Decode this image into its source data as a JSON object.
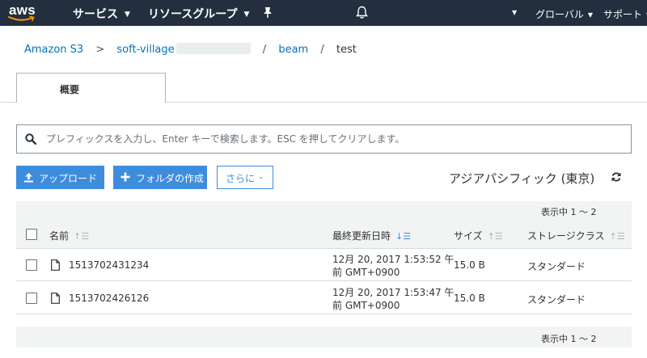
{
  "topnav": {
    "logo_text": "aws",
    "services": "サービス",
    "resource_groups": "リソースグループ",
    "global": "グローバル",
    "support": "サポート",
    "icons": [
      "pin-icon",
      "bell-icon"
    ]
  },
  "breadcrumb": {
    "root": "Amazon S3",
    "bucket": "soft-village",
    "folder": "beam",
    "current": "test",
    "separator": ">",
    "slash": "/"
  },
  "tabs": {
    "overview": "概要"
  },
  "search": {
    "placeholder": "プレフィックスを入力し、Enter キーで検索します。ESC を押してクリアします。"
  },
  "actions": {
    "upload": "アップロード",
    "create_folder": "フォルダの作成",
    "more": "さらに",
    "region": "アジアパシフィック (東京)"
  },
  "table": {
    "pager": "表示中 1 ～ 2",
    "columns": {
      "name": "名前",
      "last_modified": "最終更新日時",
      "size": "サイズ",
      "storage_class": "ストレージクラス"
    },
    "rows": [
      {
        "name": "1513702431234",
        "date_line1": "12月 20, 2017 1:53:52 午",
        "date_line2": "前 GMT+0900",
        "size": "15.0 B",
        "storage_class": "スタンダード"
      },
      {
        "name": "1513702426126",
        "date_line1": "12月 20, 2017 1:53:47 午",
        "date_line2": "前 GMT+0900",
        "size": "15.0 B",
        "storage_class": "スタンダード"
      }
    ]
  },
  "colors": {
    "nav_bg": "#232f3e",
    "link": "#0073bb",
    "primary_button": "#3e8ddd",
    "table_header_bg": "#f2f3f3"
  }
}
